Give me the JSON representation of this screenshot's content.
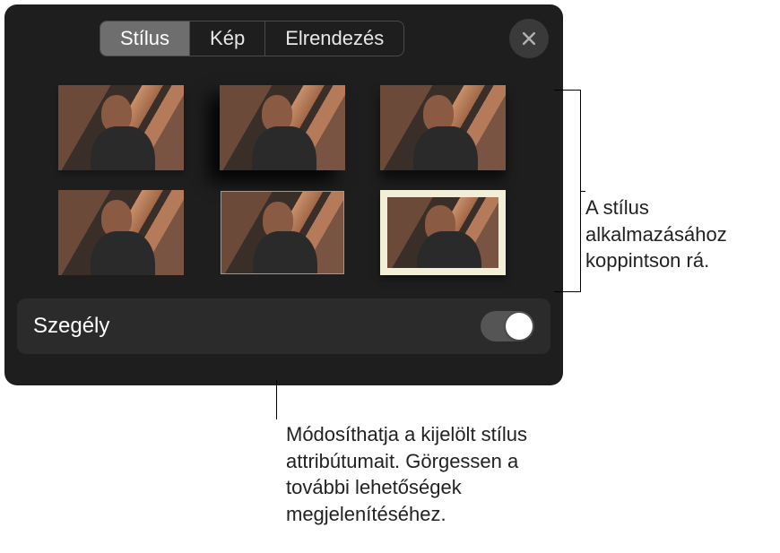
{
  "tabs": {
    "style": "Stílus",
    "image": "Kép",
    "layout": "Elrendezés"
  },
  "option": {
    "border_label": "Szegély"
  },
  "callouts": {
    "right": "A stílus alkalmazásához koppintson rá.",
    "bottom": "Módosíthatja a kijelölt stílus attribútumait. Görgessen a további lehetőségek megjelenítéséhez."
  }
}
